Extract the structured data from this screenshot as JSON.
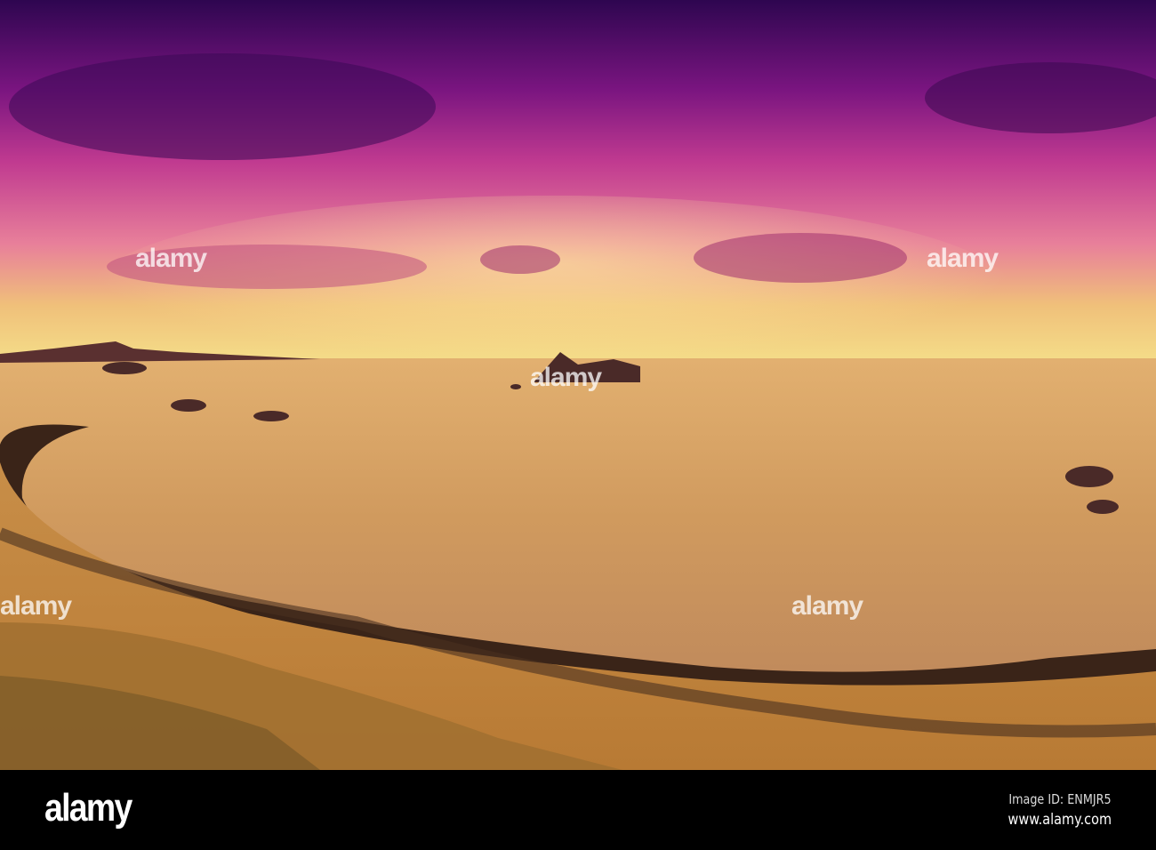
{
  "watermark": {
    "text": "alamy"
  },
  "footer": {
    "logo": "alamy",
    "image_id": "Image ID: ENMJR5",
    "url": "www.alamy.com"
  },
  "colors": {
    "sky_top": "#2e0650",
    "sky_mid": "#b02a8a",
    "horizon": "#f2d680",
    "sea": "#d4a060",
    "sand": "#c48a44",
    "footer_bg": "#000000"
  }
}
